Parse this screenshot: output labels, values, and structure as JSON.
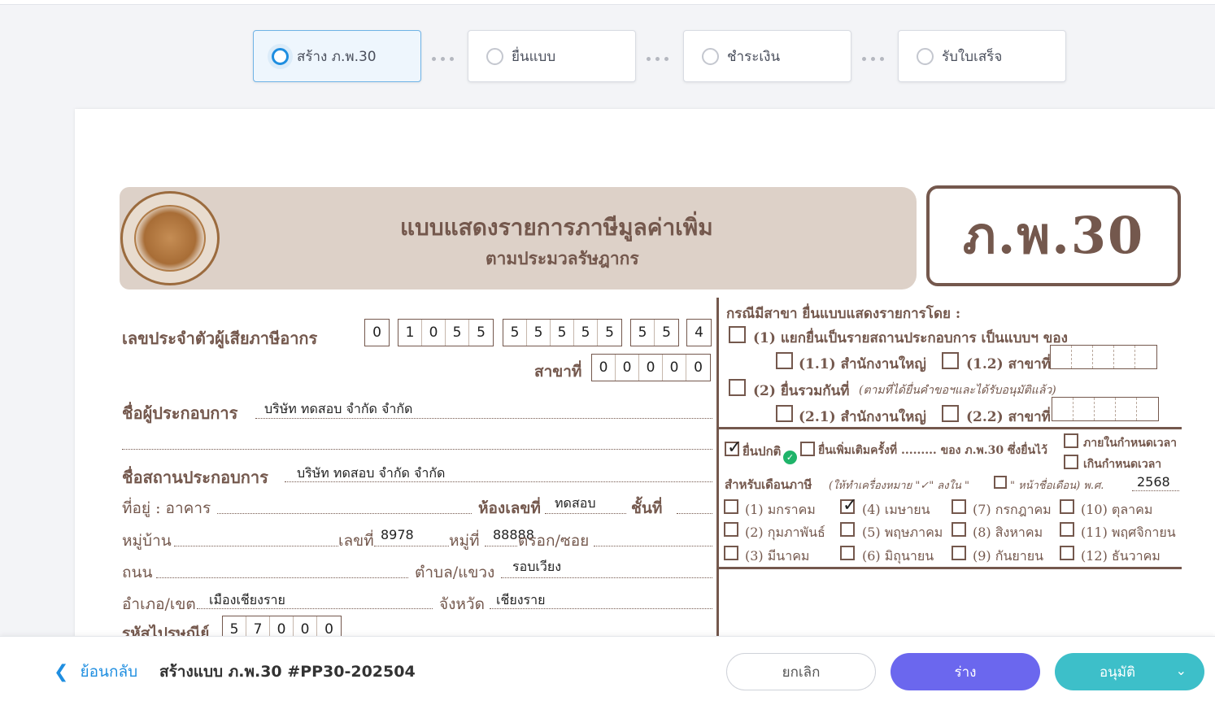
{
  "stepper": [
    {
      "label": "สร้าง ภ.พ.30",
      "active": true
    },
    {
      "label": "ยื่นแบบ",
      "active": false
    },
    {
      "label": "ชำระเงิน",
      "active": false
    },
    {
      "label": "รับใบเสร็จ",
      "active": false
    }
  ],
  "form": {
    "title": "แบบแสดงรายการภาษีมูลค่าเพิ่ม",
    "subtitle": "ตามประมวลรัษฎากร",
    "code": "ภ.พ.30",
    "tax_id_label": "เลขประจำตัวผู้เสียภาษีอากร",
    "tax_id_digits": [
      "0",
      "1",
      "0",
      "5",
      "5",
      "5",
      "5",
      "5",
      "5",
      "5",
      "5",
      "5",
      "4"
    ],
    "branch_label": "สาขาที่",
    "branch_digits": [
      "0",
      "0",
      "0",
      "0",
      "0"
    ],
    "operator_label": "ชื่อผู้ประกอบการ",
    "operator_value": "บริษัท ทดสอบ จำกัด จำกัด",
    "business_label": "ชื่อสถานประกอบการ",
    "business_value": "บริษัท ทดสอบ จำกัด จำกัด",
    "address_label": "ที่อยู่ : อาคาร",
    "room_label": "ห้องเลขที่",
    "room_value": "ทดสอบ",
    "floor_label": "ชั้นที่",
    "village_label": "หมู่บ้าน",
    "house_no_label": "เลขที่",
    "house_no_value": "8978",
    "moo_label": "หมู่ที่",
    "moo_value": "88888",
    "soi_label": "ตรอก/ซอย",
    "road_label": "ถนน",
    "subdistrict_label": "ตำบล/แขวง",
    "subdistrict_value": "รอบเวียง",
    "district_label": "อำเภอ/เขต",
    "district_value": "เมืองเชียงราย",
    "province_label": "จังหวัด",
    "province_value": "เชียงราย",
    "postcode_label": "รหัสไปรษณีย์",
    "postcode_digits": [
      "5",
      "7",
      "0",
      "0",
      "0"
    ],
    "branch_case_title": "กรณีมีสาขา ยื่นแบบแสดงรายการโดย :",
    "opt_1": "(1) แยกยื่นเป็นรายสถานประกอบการ เป็นแบบฯ ของ",
    "opt_1_1": "(1.1) สำนักงานใหญ่",
    "opt_1_2": "(1.2) สาขาที่",
    "opt_2": "(2) ยื่นรวมกันที่",
    "opt_2_note": "(ตามที่ได้ยื่นคำขอฯและได้รับอนุมัติแล้ว)",
    "opt_2_1": "(2.1) สำนักงานใหญ่",
    "opt_2_2": "(2.2) สาขาที่",
    "normal_filing": "ยื่นปกติ",
    "normal_checked": true,
    "additional_filing": "ยื่นเพิ่มเติมครั้งที่ ......... ของ ภ.พ.30 ซึ่งยื่นไว้",
    "within_deadline": "ภายในกำหนดเวลา",
    "past_deadline": "เกินกำหนดเวลา",
    "tax_month_label": "สำหรับเดือนภาษี",
    "tax_month_note": "(ให้ทำเครื่องหมาย \"✓\" ลงใน \"",
    "tax_month_note2": "\" หน้าชื่อเดือน) พ.ศ.",
    "year_value": "2568",
    "months": [
      {
        "label": "(1) มกราคม",
        "checked": false
      },
      {
        "label": "(2) กุมภาพันธ์",
        "checked": false
      },
      {
        "label": "(3) มีนาคม",
        "checked": false
      },
      {
        "label": "(4) เมษายน",
        "checked": true
      },
      {
        "label": "(5) พฤษภาคม",
        "checked": false
      },
      {
        "label": "(6) มิถุนายน",
        "checked": false
      },
      {
        "label": "(7) กรกฎาคม",
        "checked": false
      },
      {
        "label": "(8) สิงหาคม",
        "checked": false
      },
      {
        "label": "(9) กันยายน",
        "checked": false
      },
      {
        "label": "(10) ตุลาคม",
        "checked": false
      },
      {
        "label": "(11) พฤศจิกายน",
        "checked": false
      },
      {
        "label": "(12) ธันวาคม",
        "checked": false
      }
    ],
    "colors": {
      "brown": "#74584d",
      "banner": "#ddd1c8"
    }
  },
  "footer": {
    "back_label": "ย้อนกลับ",
    "doc_title": "สร้างแบบ ภ.พ.30 #PP30-202504",
    "cancel_label": "ยกเลิก",
    "draft_label": "ร่าง",
    "approve_label": "อนุมัติ"
  },
  "colors": {
    "primary": "#1f8ee0",
    "draft": "#6b67ee",
    "approve": "#3dbfc9"
  },
  "icons": {
    "back": "chevron-left-icon",
    "approve_caret": "chevron-down-icon",
    "validated": "check-circle-icon"
  }
}
